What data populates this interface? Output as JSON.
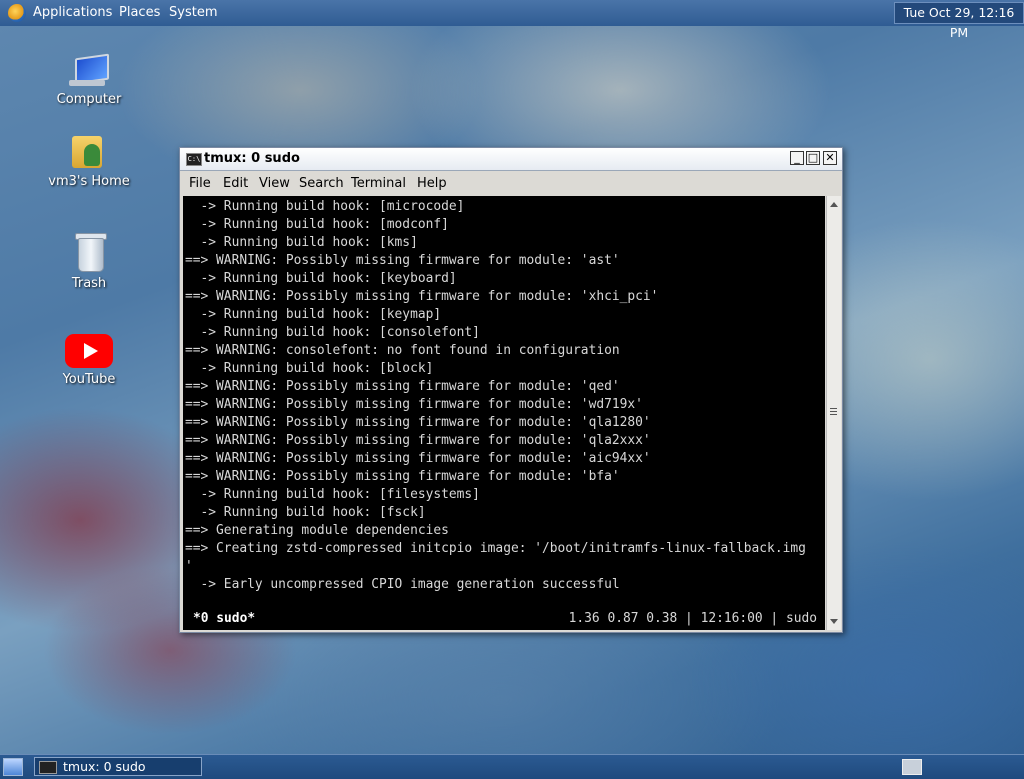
{
  "top_panel": {
    "menus": [
      "Applications",
      "Places",
      "System"
    ],
    "clock": "Tue Oct 29, 12:16 PM"
  },
  "desktop_icons": [
    "Computer",
    "vm3's Home",
    "Trash",
    "YouTube"
  ],
  "window": {
    "title": "tmux: 0 sudo",
    "menu": [
      "File",
      "Edit",
      "View",
      "Search",
      "Terminal",
      "Help"
    ],
    "terminal_lines": [
      "  -> Running build hook: [microcode]",
      "  -> Running build hook: [modconf]",
      "  -> Running build hook: [kms]",
      "==> WARNING: Possibly missing firmware for module: 'ast'",
      "  -> Running build hook: [keyboard]",
      "==> WARNING: Possibly missing firmware for module: 'xhci_pci'",
      "  -> Running build hook: [keymap]",
      "  -> Running build hook: [consolefont]",
      "==> WARNING: consolefont: no font found in configuration",
      "  -> Running build hook: [block]",
      "==> WARNING: Possibly missing firmware for module: 'qed'",
      "==> WARNING: Possibly missing firmware for module: 'wd719x'",
      "==> WARNING: Possibly missing firmware for module: 'qla1280'",
      "==> WARNING: Possibly missing firmware for module: 'qla2xxx'",
      "==> WARNING: Possibly missing firmware for module: 'aic94xx'",
      "==> WARNING: Possibly missing firmware for module: 'bfa'",
      "  -> Running build hook: [filesystems]",
      "  -> Running build hook: [fsck]",
      "==> Generating module dependencies",
      "==> Creating zstd-compressed initcpio image: '/boot/initramfs-linux-fallback.img",
      "'",
      "  -> Early uncompressed CPIO image generation successful",
      ""
    ],
    "status_left": "*0 sudo*",
    "status_right": "1.36 0.87 0.38 | 12:16:00 | sudo"
  },
  "taskbar": {
    "task_label": "tmux: 0 sudo"
  }
}
